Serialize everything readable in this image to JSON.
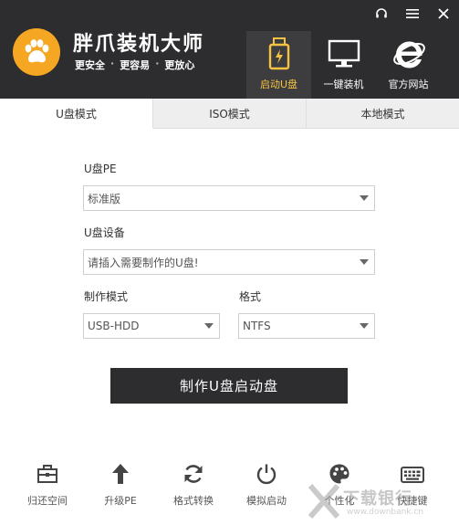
{
  "header": {
    "app_title": "胖爪装机大师",
    "slogans": [
      "更安全",
      "更容易",
      "更放心"
    ],
    "slogan_separator": "·"
  },
  "nav": [
    {
      "label": "启动U盘",
      "icon": "usb-drive-icon",
      "active": true
    },
    {
      "label": "一键装机",
      "icon": "monitor-icon",
      "active": false
    },
    {
      "label": "官方网站",
      "icon": "ie-browser-icon",
      "active": false
    }
  ],
  "tabs": [
    {
      "label": "U盘模式",
      "active": true
    },
    {
      "label": "ISO模式",
      "active": false
    },
    {
      "label": "本地模式",
      "active": false
    }
  ],
  "form": {
    "pe_label": "U盘PE",
    "pe_value": "标准版",
    "device_label": "U盘设备",
    "device_value": "请插入需要制作的U盘!",
    "mode_label": "制作模式",
    "mode_value": "USB-HDD",
    "format_label": "格式",
    "format_value": "NTFS",
    "submit_label": "制作U盘启动盘"
  },
  "toolbar": [
    {
      "label": "归还空间",
      "icon": "toolbox-icon"
    },
    {
      "label": "升级PE",
      "icon": "arrow-up-icon"
    },
    {
      "label": "格式转换",
      "icon": "refresh-icon"
    },
    {
      "label": "模拟启动",
      "icon": "power-icon"
    },
    {
      "label": "个性化",
      "icon": "palette-icon"
    },
    {
      "label": "快捷键",
      "icon": "keyboard-icon"
    }
  ],
  "watermark": {
    "text": "下载银行",
    "sub": "www.downbank.cn"
  },
  "colors": {
    "header_bg": "#2d2d30",
    "accent": "#f5a623",
    "active_nav_label": "#f5c242",
    "button_bg": "#2d2d30"
  }
}
